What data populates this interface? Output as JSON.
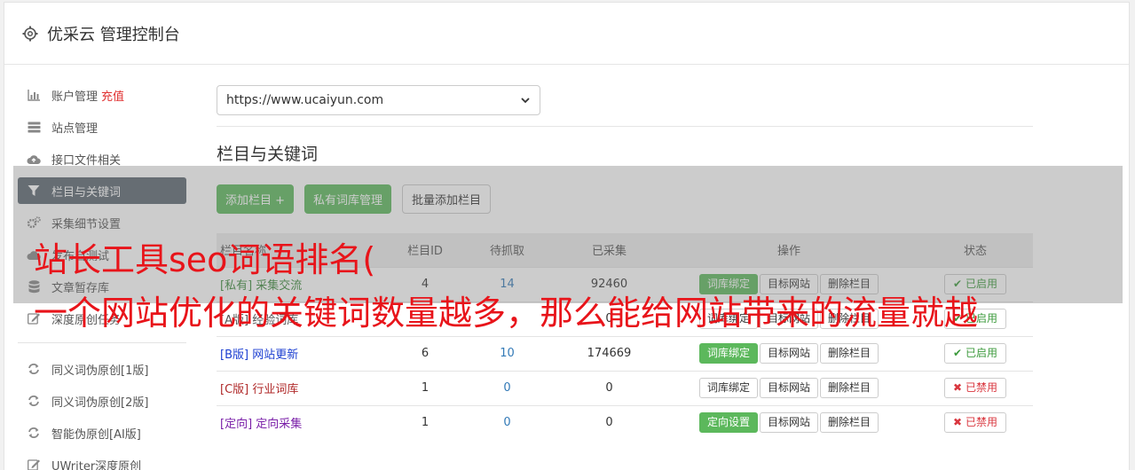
{
  "header": {
    "title": "优采云 管理控制台"
  },
  "sidebar": {
    "items": [
      {
        "label": "账户管理",
        "tag": "充值",
        "icon": "bar-chart-icon",
        "active": false
      },
      {
        "label": "站点管理",
        "icon": "server-icon",
        "active": false
      },
      {
        "label": "接口文件相关",
        "icon": "cloud-upload-icon",
        "active": false
      },
      {
        "label": "栏目与关键词",
        "icon": "filter-icon",
        "active": true
      },
      {
        "label": "采集细节设置",
        "icon": "cogs-icon",
        "active": false
      },
      {
        "label": "发布自测试",
        "icon": "cloud-icon",
        "active": false
      },
      {
        "label": "文章暂存库",
        "icon": "database-icon",
        "active": false
      },
      {
        "label": "深度原创任务",
        "icon": "edit-icon",
        "active": false
      }
    ],
    "tools": [
      {
        "label": "同义词伪原创[1版]",
        "icon": "refresh-icon"
      },
      {
        "label": "同义词伪原创[2版]",
        "icon": "refresh-icon"
      },
      {
        "label": "智能伪原创[AI版]",
        "icon": "refresh-icon"
      },
      {
        "label": "UWriter深度原创",
        "icon": "edit-icon"
      }
    ]
  },
  "site_select": {
    "value": "https://www.ucaiyun.com"
  },
  "section": {
    "title": "栏目与关键词"
  },
  "actions": {
    "add_column": "添加栏目 +",
    "private_lib": "私有词库管理",
    "batch_add": "批量添加栏目"
  },
  "table": {
    "headers": [
      "栏目名称",
      "栏目ID",
      "待抓取",
      "已采集",
      "操作",
      "状态"
    ],
    "rows": [
      {
        "prefix": "[私有]",
        "name": "采集交流",
        "color": "#3c8a3c",
        "id": "4",
        "pending": "14",
        "collected": "92460",
        "bind": "词库绑定",
        "bind_green": true,
        "site": "目标网站",
        "delete": "删除栏目",
        "status": "已启用",
        "on": true
      },
      {
        "prefix": "[A版]",
        "name": "经验词库",
        "color": "#555555",
        "id": "",
        "pending": "",
        "collected": "0",
        "bind": "词库绑定",
        "bind_green": false,
        "site": "目标网站",
        "delete": "删除栏目",
        "status": "已启用",
        "on": true
      },
      {
        "prefix": "[B版]",
        "name": "网站更新",
        "color": "#1c3fd1",
        "id": "6",
        "pending": "10",
        "collected": "174669",
        "bind": "词库绑定",
        "bind_green": true,
        "site": "目标网站",
        "delete": "删除栏目",
        "status": "已启用",
        "on": true
      },
      {
        "prefix": "[C版]",
        "name": "行业词库",
        "color": "#b02a2a",
        "id": "1",
        "pending": "0",
        "collected": "0",
        "bind": "词库绑定",
        "bind_green": false,
        "site": "目标网站",
        "delete": "删除栏目",
        "status": "已禁用",
        "on": false
      },
      {
        "prefix": "[定向]",
        "name": "定向采集",
        "color": "#7a1fa8",
        "id": "1",
        "pending": "0",
        "collected": "0",
        "bind": "定向设置",
        "bind_green": true,
        "site": "目标网站",
        "delete": "删除栏目",
        "status": "已禁用",
        "on": false
      }
    ]
  },
  "watermark": {
    "line1": "站长工具seo词语排名(",
    "line2": "一个网站优化的关键词数量越多，那么能给网站带来的流量就越"
  }
}
